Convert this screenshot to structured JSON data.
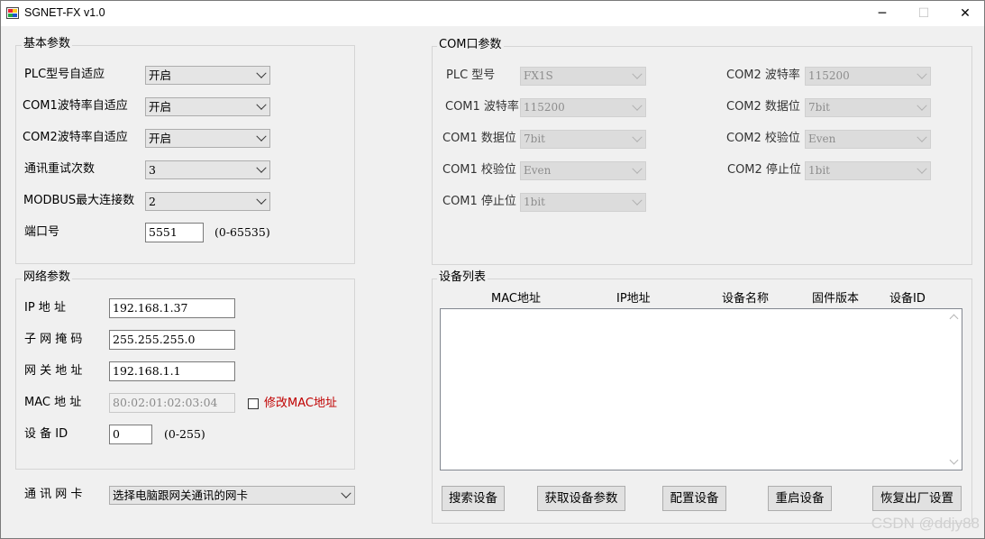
{
  "window": {
    "title": "SGNET-FX v1.0",
    "min": "─",
    "max": "☐",
    "close": "✕"
  },
  "basic": {
    "title": "基本参数",
    "plc_adapt_label": "PLC型号自适应",
    "plc_adapt_value": "开启",
    "com1_adapt_label": "COM1波特率自适应",
    "com1_adapt_value": "开启",
    "com2_adapt_label": "COM2波特率自适应",
    "com2_adapt_value": "开启",
    "retry_label": "通讯重试次数",
    "retry_value": "3",
    "modbus_label": "MODBUS最大连接数",
    "modbus_value": "2",
    "port_label": "端口号",
    "port_value": "5551",
    "port_range": "(0-65535)"
  },
  "network": {
    "title": "网络参数",
    "ip_label": "IP 地 址",
    "ip_value": "192.168.1.37",
    "mask_label": "子 网 掩 码",
    "mask_value": "255.255.255.0",
    "gateway_label": "网 关 地 址",
    "gateway_value": "192.168.1.1",
    "mac_label": "MAC  地 址",
    "mac_value": "80:02:01:02:03:04",
    "modify_mac_label": "修改MAC地址",
    "device_id_label": "设 备 ID",
    "device_id_value": "0",
    "device_id_range": "(0-255)"
  },
  "nic": {
    "label": "通 讯 网 卡",
    "value": "选择电脑跟网关通讯的网卡"
  },
  "com": {
    "title": "COM口参数",
    "plc_type_label": "PLC 型号",
    "plc_type_value": "FX1S",
    "com1_baud_label": "COM1 波特率",
    "com1_baud_value": "115200",
    "com1_data_label": "COM1 数据位",
    "com1_data_value": "7bit",
    "com1_parity_label": "COM1 校验位",
    "com1_parity_value": "Even",
    "com1_stop_label": "COM1 停止位",
    "com1_stop_value": "1bit",
    "com2_baud_label": "COM2 波特率",
    "com2_baud_value": "115200",
    "com2_data_label": "COM2 数据位",
    "com2_data_value": "7bit",
    "com2_parity_label": "COM2 校验位",
    "com2_parity_value": "Even",
    "com2_stop_label": "COM2 停止位",
    "com2_stop_value": "1bit"
  },
  "devices": {
    "title": "设备列表",
    "columns": [
      "MAC地址",
      "IP地址",
      "设备名称",
      "固件版本",
      "设备ID"
    ],
    "rows": []
  },
  "buttons": {
    "search": "搜索设备",
    "get_params": "获取设备参数",
    "config": "配置设备",
    "restart": "重启设备",
    "factory_reset": "恢复出厂设置"
  },
  "watermark": "CSDN @ddjy88"
}
